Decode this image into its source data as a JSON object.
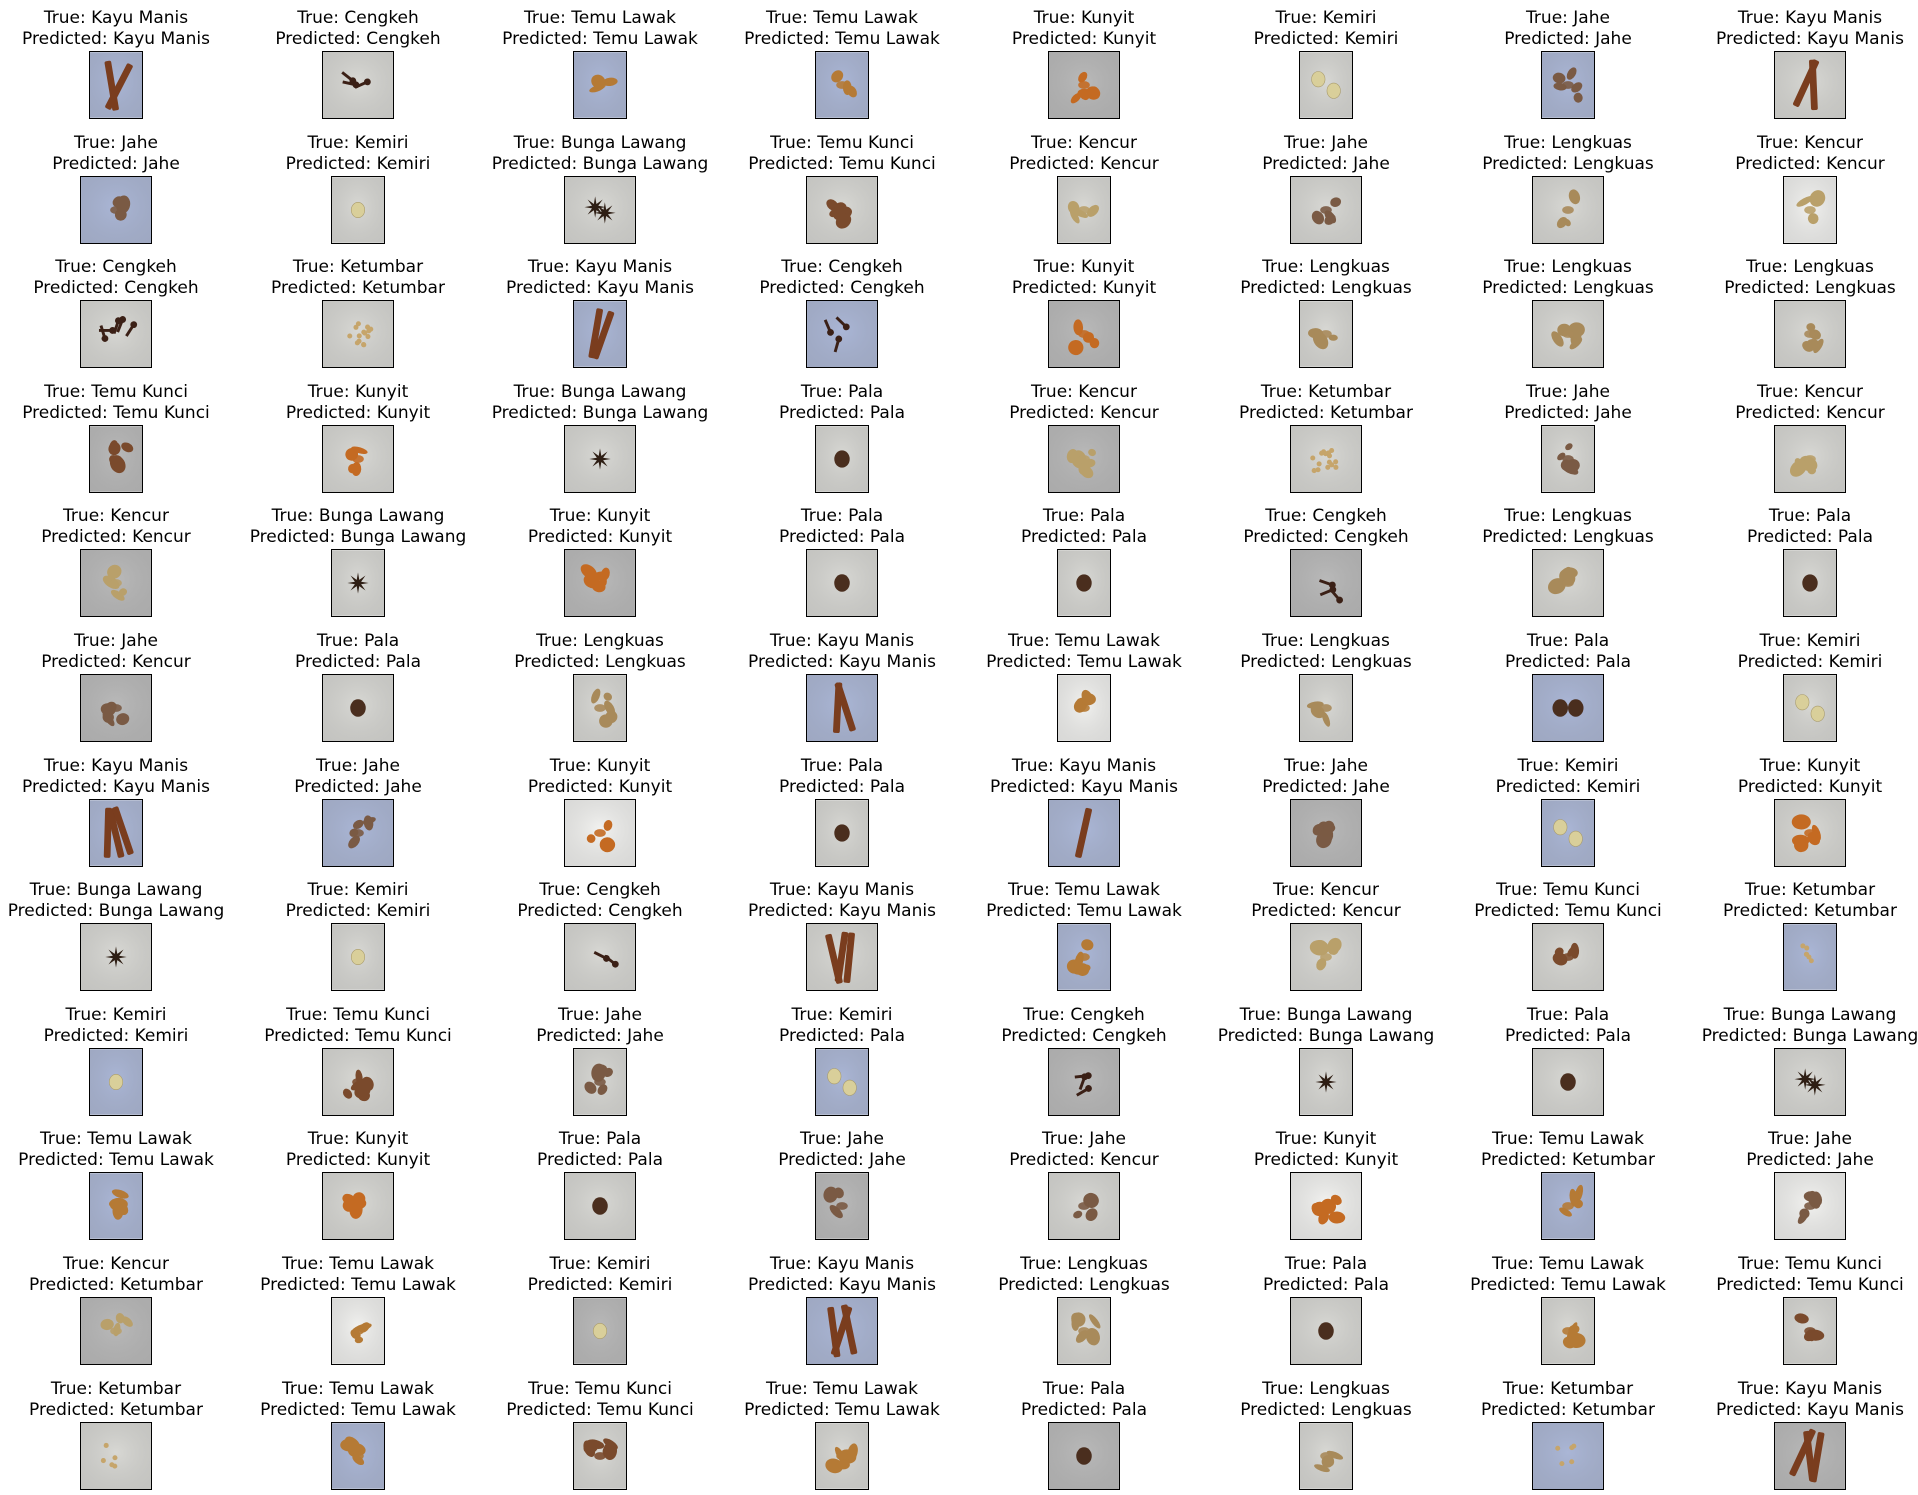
{
  "bg_colors": {
    "blue": "#aab6d6",
    "gray": "#b9b9b9",
    "light": "#d8d8d4",
    "white": "#f2f2f0",
    "dark": "#8d8d8d"
  },
  "spice_colors": {
    "Kayu Manis": "#7a3d1e",
    "Cengkeh": "#3b2016",
    "Temu Lawak": "#b57a35",
    "Kunyit": "#c46a22",
    "Kemiri": "#d9cf9a",
    "Jahe": "#7a5a44",
    "Bunga Lawang": "#2e1e14",
    "Temu Kunci": "#7a4a2c",
    "Kencur": "#b9a06a",
    "Lengkuas": "#a88a5a",
    "Ketumbar": "#c6a56b",
    "Pala": "#4a2e1e"
  },
  "samples": [
    {
      "true_label": "True: Kayu Manis",
      "pred_label": "Predicted: Kayu Manis",
      "spice": "Kayu Manis",
      "bg": "blue"
    },
    {
      "true_label": "True: Cengkeh",
      "pred_label": "Predicted: Cengkeh",
      "spice": "Cengkeh",
      "bg": "light"
    },
    {
      "true_label": "True: Temu Lawak",
      "pred_label": "Predicted: Temu Lawak",
      "spice": "Temu Lawak",
      "bg": "blue"
    },
    {
      "true_label": "True: Temu Lawak",
      "pred_label": "Predicted: Temu Lawak",
      "spice": "Temu Lawak",
      "bg": "blue"
    },
    {
      "true_label": "True: Kunyit",
      "pred_label": "Predicted: Kunyit",
      "spice": "Kunyit",
      "bg": "gray"
    },
    {
      "true_label": "True: Kemiri",
      "pred_label": "Predicted: Kemiri",
      "spice": "Kemiri",
      "bg": "light"
    },
    {
      "true_label": "True: Jahe",
      "pred_label": "Predicted: Jahe",
      "spice": "Jahe",
      "bg": "blue"
    },
    {
      "true_label": "True: Kayu Manis",
      "pred_label": "Predicted: Kayu Manis",
      "spice": "Kayu Manis",
      "bg": "light"
    },
    {
      "true_label": "True: Jahe",
      "pred_label": "Predicted: Jahe",
      "spice": "Jahe",
      "bg": "blue"
    },
    {
      "true_label": "True: Kemiri",
      "pred_label": "Predicted: Kemiri",
      "spice": "Kemiri",
      "bg": "light"
    },
    {
      "true_label": "True: Bunga Lawang",
      "pred_label": "Predicted: Bunga Lawang",
      "spice": "Bunga Lawang",
      "bg": "light"
    },
    {
      "true_label": "True: Temu Kunci",
      "pred_label": "Predicted: Temu Kunci",
      "spice": "Temu Kunci",
      "bg": "light"
    },
    {
      "true_label": "True: Kencur",
      "pred_label": "Predicted: Kencur",
      "spice": "Kencur",
      "bg": "light"
    },
    {
      "true_label": "True: Jahe",
      "pred_label": "Predicted: Jahe",
      "spice": "Jahe",
      "bg": "light"
    },
    {
      "true_label": "True: Lengkuas",
      "pred_label": "Predicted: Lengkuas",
      "spice": "Lengkuas",
      "bg": "light"
    },
    {
      "true_label": "True: Kencur",
      "pred_label": "Predicted: Kencur",
      "spice": "Kencur",
      "bg": "white"
    },
    {
      "true_label": "True: Cengkeh",
      "pred_label": "Predicted: Cengkeh",
      "spice": "Cengkeh",
      "bg": "light"
    },
    {
      "true_label": "True: Ketumbar",
      "pred_label": "Predicted: Ketumbar",
      "spice": "Ketumbar",
      "bg": "light"
    },
    {
      "true_label": "True: Kayu Manis",
      "pred_label": "Predicted: Kayu Manis",
      "spice": "Kayu Manis",
      "bg": "blue"
    },
    {
      "true_label": "True: Cengkeh",
      "pred_label": "Predicted: Cengkeh",
      "spice": "Cengkeh",
      "bg": "blue"
    },
    {
      "true_label": "True: Kunyit",
      "pred_label": "Predicted: Kunyit",
      "spice": "Kunyit",
      "bg": "gray"
    },
    {
      "true_label": "True: Lengkuas",
      "pred_label": "Predicted: Lengkuas",
      "spice": "Lengkuas",
      "bg": "light"
    },
    {
      "true_label": "True: Lengkuas",
      "pred_label": "Predicted: Lengkuas",
      "spice": "Lengkuas",
      "bg": "light"
    },
    {
      "true_label": "True: Lengkuas",
      "pred_label": "Predicted: Lengkuas",
      "spice": "Lengkuas",
      "bg": "light"
    },
    {
      "true_label": "True: Temu Kunci",
      "pred_label": "Predicted: Temu Kunci",
      "spice": "Temu Kunci",
      "bg": "gray"
    },
    {
      "true_label": "True: Kunyit",
      "pred_label": "Predicted: Kunyit",
      "spice": "Kunyit",
      "bg": "light"
    },
    {
      "true_label": "True: Bunga Lawang",
      "pred_label": "Predicted: Bunga Lawang",
      "spice": "Bunga Lawang",
      "bg": "light"
    },
    {
      "true_label": "True: Pala",
      "pred_label": "Predicted: Pala",
      "spice": "Pala",
      "bg": "light"
    },
    {
      "true_label": "True: Kencur",
      "pred_label": "Predicted: Kencur",
      "spice": "Kencur",
      "bg": "gray"
    },
    {
      "true_label": "True: Ketumbar",
      "pred_label": "Predicted: Ketumbar",
      "spice": "Ketumbar",
      "bg": "light"
    },
    {
      "true_label": "True: Jahe",
      "pred_label": "Predicted: Jahe",
      "spice": "Jahe",
      "bg": "light"
    },
    {
      "true_label": "True: Kencur",
      "pred_label": "Predicted: Kencur",
      "spice": "Kencur",
      "bg": "light"
    },
    {
      "true_label": "True: Kencur",
      "pred_label": "Predicted: Kencur",
      "spice": "Kencur",
      "bg": "gray"
    },
    {
      "true_label": "True: Bunga Lawang",
      "pred_label": "Predicted: Bunga Lawang",
      "spice": "Bunga Lawang",
      "bg": "light"
    },
    {
      "true_label": "True: Kunyit",
      "pred_label": "Predicted: Kunyit",
      "spice": "Kunyit",
      "bg": "gray"
    },
    {
      "true_label": "True: Pala",
      "pred_label": "Predicted: Pala",
      "spice": "Pala",
      "bg": "light"
    },
    {
      "true_label": "True: Pala",
      "pred_label": "Predicted: Pala",
      "spice": "Pala",
      "bg": "light"
    },
    {
      "true_label": "True: Cengkeh",
      "pred_label": "Predicted: Cengkeh",
      "spice": "Cengkeh",
      "bg": "gray"
    },
    {
      "true_label": "True: Lengkuas",
      "pred_label": "Predicted: Lengkuas",
      "spice": "Lengkuas",
      "bg": "light"
    },
    {
      "true_label": "True: Pala",
      "pred_label": "Predicted: Pala",
      "spice": "Pala",
      "bg": "light"
    },
    {
      "true_label": "True: Jahe",
      "pred_label": "Predicted: Kencur",
      "spice": "Jahe",
      "bg": "gray"
    },
    {
      "true_label": "True: Pala",
      "pred_label": "Predicted: Pala",
      "spice": "Pala",
      "bg": "light"
    },
    {
      "true_label": "True: Lengkuas",
      "pred_label": "Predicted: Lengkuas",
      "spice": "Lengkuas",
      "bg": "light"
    },
    {
      "true_label": "True: Kayu Manis",
      "pred_label": "Predicted: Kayu Manis",
      "spice": "Kayu Manis",
      "bg": "blue"
    },
    {
      "true_label": "True: Temu Lawak",
      "pred_label": "Predicted: Temu Lawak",
      "spice": "Temu Lawak",
      "bg": "white"
    },
    {
      "true_label": "True: Lengkuas",
      "pred_label": "Predicted: Lengkuas",
      "spice": "Lengkuas",
      "bg": "light"
    },
    {
      "true_label": "True: Pala",
      "pred_label": "Predicted: Pala",
      "spice": "Pala",
      "bg": "blue"
    },
    {
      "true_label": "True: Kemiri",
      "pred_label": "Predicted: Kemiri",
      "spice": "Kemiri",
      "bg": "light"
    },
    {
      "true_label": "True: Kayu Manis",
      "pred_label": "Predicted: Kayu Manis",
      "spice": "Kayu Manis",
      "bg": "blue"
    },
    {
      "true_label": "True: Jahe",
      "pred_label": "Predicted: Jahe",
      "spice": "Jahe",
      "bg": "blue"
    },
    {
      "true_label": "True: Kunyit",
      "pred_label": "Predicted: Kunyit",
      "spice": "Kunyit",
      "bg": "white"
    },
    {
      "true_label": "True: Pala",
      "pred_label": "Predicted: Pala",
      "spice": "Pala",
      "bg": "light"
    },
    {
      "true_label": "True: Kayu Manis",
      "pred_label": "Predicted: Kayu Manis",
      "spice": "Kayu Manis",
      "bg": "blue"
    },
    {
      "true_label": "True: Jahe",
      "pred_label": "Predicted: Jahe",
      "spice": "Jahe",
      "bg": "gray"
    },
    {
      "true_label": "True: Kemiri",
      "pred_label": "Predicted: Kemiri",
      "spice": "Kemiri",
      "bg": "blue"
    },
    {
      "true_label": "True: Kunyit",
      "pred_label": "Predicted: Kunyit",
      "spice": "Kunyit",
      "bg": "light"
    },
    {
      "true_label": "True: Bunga Lawang",
      "pred_label": "Predicted: Bunga Lawang",
      "spice": "Bunga Lawang",
      "bg": "light"
    },
    {
      "true_label": "True: Kemiri",
      "pred_label": "Predicted: Kemiri",
      "spice": "Kemiri",
      "bg": "light"
    },
    {
      "true_label": "True: Cengkeh",
      "pred_label": "Predicted: Cengkeh",
      "spice": "Cengkeh",
      "bg": "light"
    },
    {
      "true_label": "True: Kayu Manis",
      "pred_label": "Predicted: Kayu Manis",
      "spice": "Kayu Manis",
      "bg": "light"
    },
    {
      "true_label": "True: Temu Lawak",
      "pred_label": "Predicted: Temu Lawak",
      "spice": "Temu Lawak",
      "bg": "blue"
    },
    {
      "true_label": "True: Kencur",
      "pred_label": "Predicted: Kencur",
      "spice": "Kencur",
      "bg": "light"
    },
    {
      "true_label": "True: Temu Kunci",
      "pred_label": "Predicted: Temu Kunci",
      "spice": "Temu Kunci",
      "bg": "light"
    },
    {
      "true_label": "True: Ketumbar",
      "pred_label": "Predicted: Ketumbar",
      "spice": "Ketumbar",
      "bg": "blue"
    },
    {
      "true_label": "True: Kemiri",
      "pred_label": "Predicted: Kemiri",
      "spice": "Kemiri",
      "bg": "blue"
    },
    {
      "true_label": "True: Temu Kunci",
      "pred_label": "Predicted: Temu Kunci",
      "spice": "Temu Kunci",
      "bg": "light"
    },
    {
      "true_label": "True: Jahe",
      "pred_label": "Predicted: Jahe",
      "spice": "Jahe",
      "bg": "light"
    },
    {
      "true_label": "True: Kemiri",
      "pred_label": "Predicted: Pala",
      "spice": "Kemiri",
      "bg": "blue"
    },
    {
      "true_label": "True: Cengkeh",
      "pred_label": "Predicted: Cengkeh",
      "spice": "Cengkeh",
      "bg": "gray"
    },
    {
      "true_label": "True: Bunga Lawang",
      "pred_label": "Predicted: Bunga Lawang",
      "spice": "Bunga Lawang",
      "bg": "light"
    },
    {
      "true_label": "True: Pala",
      "pred_label": "Predicted: Pala",
      "spice": "Pala",
      "bg": "light"
    },
    {
      "true_label": "True: Bunga Lawang",
      "pred_label": "Predicted: Bunga Lawang",
      "spice": "Bunga Lawang",
      "bg": "light"
    },
    {
      "true_label": "True: Temu Lawak",
      "pred_label": "Predicted: Temu Lawak",
      "spice": "Temu Lawak",
      "bg": "blue"
    },
    {
      "true_label": "True: Kunyit",
      "pred_label": "Predicted: Kunyit",
      "spice": "Kunyit",
      "bg": "light"
    },
    {
      "true_label": "True: Pala",
      "pred_label": "Predicted: Pala",
      "spice": "Pala",
      "bg": "light"
    },
    {
      "true_label": "True: Jahe",
      "pred_label": "Predicted: Jahe",
      "spice": "Jahe",
      "bg": "gray"
    },
    {
      "true_label": "True: Jahe",
      "pred_label": "Predicted: Kencur",
      "spice": "Jahe",
      "bg": "light"
    },
    {
      "true_label": "True: Kunyit",
      "pred_label": "Predicted: Kunyit",
      "spice": "Kunyit",
      "bg": "white"
    },
    {
      "true_label": "True: Temu Lawak",
      "pred_label": "Predicted: Ketumbar",
      "spice": "Temu Lawak",
      "bg": "blue"
    },
    {
      "true_label": "True: Jahe",
      "pred_label": "Predicted: Jahe",
      "spice": "Jahe",
      "bg": "white"
    },
    {
      "true_label": "True: Kencur",
      "pred_label": "Predicted: Ketumbar",
      "spice": "Kencur",
      "bg": "gray"
    },
    {
      "true_label": "True: Temu Lawak",
      "pred_label": "Predicted: Temu Lawak",
      "spice": "Temu Lawak",
      "bg": "white"
    },
    {
      "true_label": "True: Kemiri",
      "pred_label": "Predicted: Kemiri",
      "spice": "Kemiri",
      "bg": "gray"
    },
    {
      "true_label": "True: Kayu Manis",
      "pred_label": "Predicted: Kayu Manis",
      "spice": "Kayu Manis",
      "bg": "blue"
    },
    {
      "true_label": "True: Lengkuas",
      "pred_label": "Predicted: Lengkuas",
      "spice": "Lengkuas",
      "bg": "light"
    },
    {
      "true_label": "True: Pala",
      "pred_label": "Predicted: Pala",
      "spice": "Pala",
      "bg": "light"
    },
    {
      "true_label": "True: Temu Lawak",
      "pred_label": "Predicted: Temu Lawak",
      "spice": "Temu Lawak",
      "bg": "light"
    },
    {
      "true_label": "True: Temu Kunci",
      "pred_label": "Predicted: Temu Kunci",
      "spice": "Temu Kunci",
      "bg": "light"
    },
    {
      "true_label": "True: Ketumbar",
      "pred_label": "Predicted: Ketumbar",
      "spice": "Ketumbar",
      "bg": "light"
    },
    {
      "true_label": "True: Temu Lawak",
      "pred_label": "Predicted: Temu Lawak",
      "spice": "Temu Lawak",
      "bg": "blue"
    },
    {
      "true_label": "True: Temu Kunci",
      "pred_label": "Predicted: Temu Kunci",
      "spice": "Temu Kunci",
      "bg": "light"
    },
    {
      "true_label": "True: Temu Lawak",
      "pred_label": "Predicted: Temu Lawak",
      "spice": "Temu Lawak",
      "bg": "light"
    },
    {
      "true_label": "True: Pala",
      "pred_label": "Predicted: Pala",
      "spice": "Pala",
      "bg": "gray"
    },
    {
      "true_label": "True: Lengkuas",
      "pred_label": "Predicted: Lengkuas",
      "spice": "Lengkuas",
      "bg": "light"
    },
    {
      "true_label": "True: Ketumbar",
      "pred_label": "Predicted: Ketumbar",
      "spice": "Ketumbar",
      "bg": "blue"
    },
    {
      "true_label": "True: Kayu Manis",
      "pred_label": "Predicted: Kayu Manis",
      "spice": "Kayu Manis",
      "bg": "gray"
    }
  ]
}
